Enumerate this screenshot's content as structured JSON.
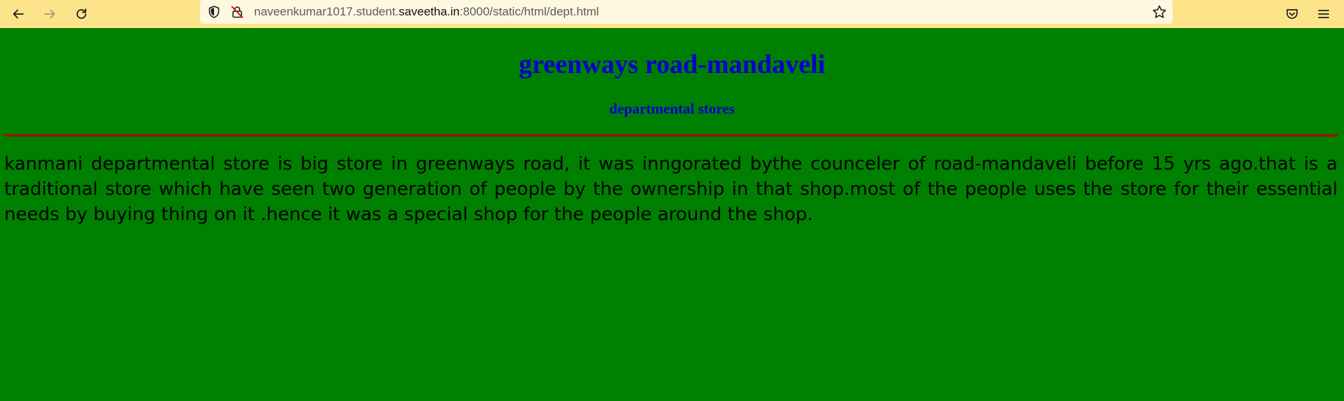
{
  "browser": {
    "url_prefix": "naveenkumar1017.student.",
    "url_host": "saveetha.in",
    "url_suffix": ":8000/static/html/dept.html"
  },
  "page": {
    "title": "greenways road-mandaveli",
    "subtitle": "departmental stores",
    "description": "kanmani departmental store is big store in greenways road, it was inngorated bythe counceler of road-mandaveli before 15 yrs ago.that is a traditional store which have seen two generation of people by the ownership in that shop.most of the people uses the store for their essential needs by buying thing on it .hence it was a special shop for the people around the shop."
  },
  "colors": {
    "toolbar": "#fde38a",
    "page_background": "#008000",
    "heading": "#0000cc",
    "divider": "#8b1a00"
  },
  "icons": {
    "back": "arrow-left-icon",
    "forward": "arrow-right-icon",
    "reload": "reload-icon",
    "shield": "tracking-protection-shield-icon",
    "lock": "insecure-lock-icon",
    "star": "bookmark-star-icon",
    "pocket": "pocket-icon",
    "menu": "hamburger-menu-icon"
  }
}
